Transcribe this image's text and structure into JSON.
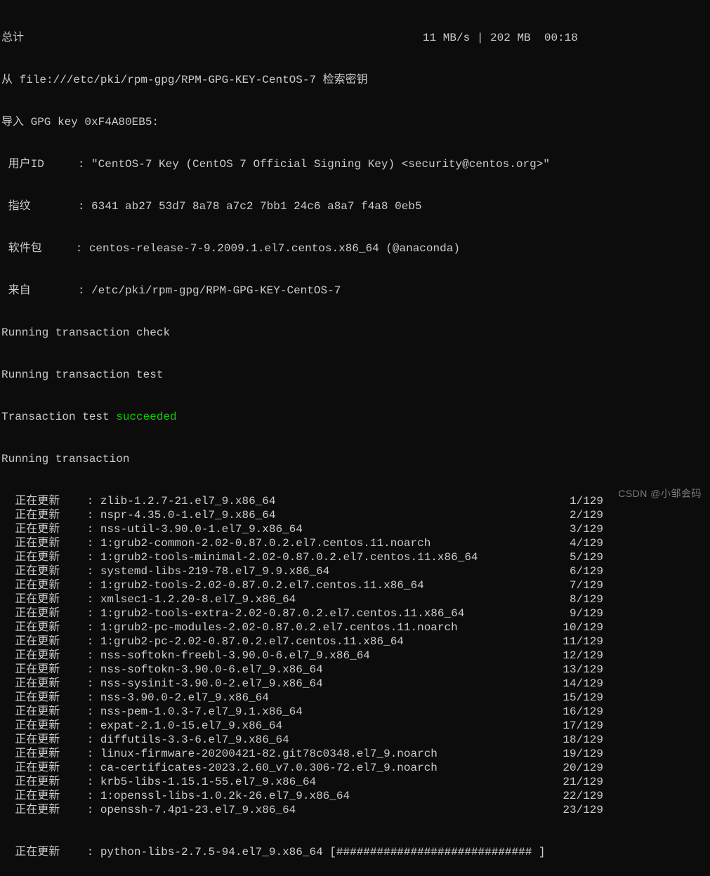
{
  "header": {
    "total_label": "总计",
    "speed": "11 MB/s",
    "sep1": "|",
    "size": "202 MB",
    "time": "00:18",
    "retrieve_line": "从 file:///etc/pki/rpm-gpg/RPM-GPG-KEY-CentOS-7 检索密钥",
    "import_line": "导入 GPG key 0xF4A80EB5:",
    "user_id_label": " 用户ID     : ",
    "user_id_value": "\"CentOS-7 Key (CentOS 7 Official Signing Key) <security@centos.org>\"",
    "fingerprint_label": " 指纹       : ",
    "fingerprint_value": "6341 ab27 53d7 8a78 a7c2 7bb1 24c6 a8a7 f4a8 0eb5",
    "package_label": " 软件包     : ",
    "package_value": "centos-release-7-9.2009.1.el7.centos.x86_64 (@anaconda)",
    "from_label": " 来自       : ",
    "from_value": "/etc/pki/rpm-gpg/RPM-GPG-KEY-CentOS-7"
  },
  "transaction": {
    "check": "Running transaction check",
    "test": "Running transaction test",
    "test_result_prefix": "Transaction test ",
    "test_result_status": "succeeded",
    "running": "Running transaction"
  },
  "update_label": "  正在更新    : ",
  "updates": [
    {
      "pkg": "zlib-1.2.7-21.el7_9.x86_64",
      "count": "1/129"
    },
    {
      "pkg": "nspr-4.35.0-1.el7_9.x86_64",
      "count": "2/129"
    },
    {
      "pkg": "nss-util-3.90.0-1.el7_9.x86_64",
      "count": "3/129"
    },
    {
      "pkg": "1:grub2-common-2.02-0.87.0.2.el7.centos.11.noarch",
      "count": "4/129"
    },
    {
      "pkg": "1:grub2-tools-minimal-2.02-0.87.0.2.el7.centos.11.x86_64",
      "count": "5/129"
    },
    {
      "pkg": "systemd-libs-219-78.el7_9.9.x86_64",
      "count": "6/129"
    },
    {
      "pkg": "1:grub2-tools-2.02-0.87.0.2.el7.centos.11.x86_64",
      "count": "7/129"
    },
    {
      "pkg": "xmlsec1-1.2.20-8.el7_9.x86_64",
      "count": "8/129"
    },
    {
      "pkg": "1:grub2-tools-extra-2.02-0.87.0.2.el7.centos.11.x86_64",
      "count": "9/129"
    },
    {
      "pkg": "1:grub2-pc-modules-2.02-0.87.0.2.el7.centos.11.noarch",
      "count": "10/129"
    },
    {
      "pkg": "1:grub2-pc-2.02-0.87.0.2.el7.centos.11.x86_64",
      "count": "11/129"
    },
    {
      "pkg": "nss-softokn-freebl-3.90.0-6.el7_9.x86_64",
      "count": "12/129"
    },
    {
      "pkg": "nss-softokn-3.90.0-6.el7_9.x86_64",
      "count": "13/129"
    },
    {
      "pkg": "nss-sysinit-3.90.0-2.el7_9.x86_64",
      "count": "14/129"
    },
    {
      "pkg": "nss-3.90.0-2.el7_9.x86_64",
      "count": "15/129"
    },
    {
      "pkg": "nss-pem-1.0.3-7.el7_9.1.x86_64",
      "count": "16/129"
    },
    {
      "pkg": "expat-2.1.0-15.el7_9.x86_64",
      "count": "17/129"
    },
    {
      "pkg": "diffutils-3.3-6.el7_9.x86_64",
      "count": "18/129"
    },
    {
      "pkg": "linux-firmware-20200421-82.git78c0348.el7_9.noarch",
      "count": "19/129"
    },
    {
      "pkg": "ca-certificates-2023.2.60_v7.0.306-72.el7_9.noarch",
      "count": "20/129"
    },
    {
      "pkg": "krb5-libs-1.15.1-55.el7_9.x86_64",
      "count": "21/129"
    },
    {
      "pkg": "1:openssl-libs-1.0.2k-26.el7_9.x86_64",
      "count": "22/129"
    },
    {
      "pkg": "openssh-7.4p1-23.el7_9.x86_64",
      "count": "23/129"
    }
  ],
  "current": {
    "pkg": "python-libs-2.7.5-94.el7_9.x86_64 ",
    "bar": "[############################# ]"
  },
  "watermark": "CSDN @小邹会码"
}
